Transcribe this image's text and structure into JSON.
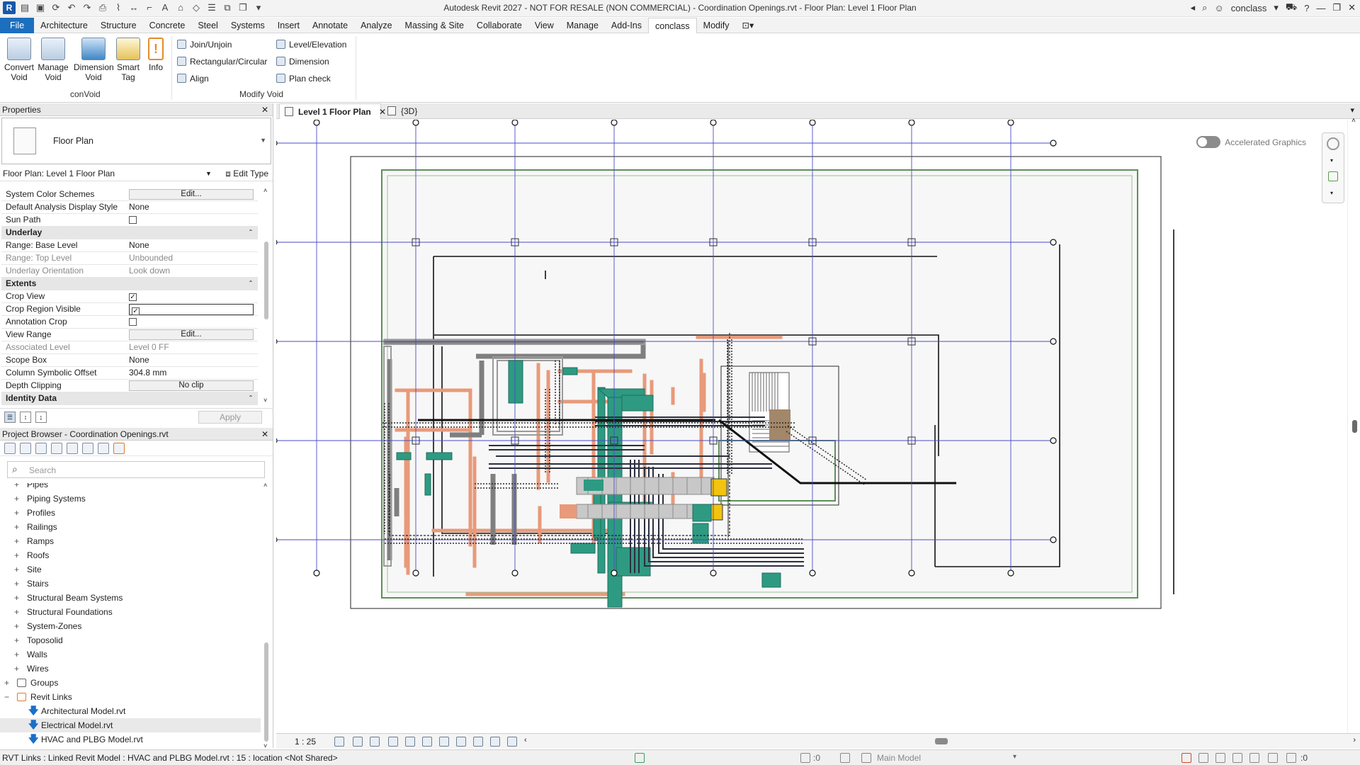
{
  "titlebar": {
    "title": "Autodesk Revit 2027 - NOT FOR RESALE (NON COMMERCIAL) - Coordination Openings.rvt - Floor Plan: Level 1 Floor Plan",
    "app_letter": "R",
    "user": "conclass"
  },
  "menu": {
    "file": "File",
    "tabs": [
      "Architecture",
      "Structure",
      "Concrete",
      "Steel",
      "Systems",
      "Insert",
      "Annotate",
      "Analyze",
      "Massing & Site",
      "Collaborate",
      "View",
      "Manage",
      "Add-Ins",
      "conclass",
      "Modify"
    ],
    "active_tab": "conclass"
  },
  "ribbon": {
    "big_buttons": [
      {
        "line1": "Convert",
        "line2": "Void"
      },
      {
        "line1": "Manage",
        "line2": "Void"
      },
      {
        "line1": "Dimension",
        "line2": "Void"
      },
      {
        "line1": "Smart",
        "line2": "Tag"
      },
      {
        "line1": "Info",
        "line2": ""
      }
    ],
    "panel1_label": "conVoid",
    "small_col1": [
      "Join/Unjoin",
      "Rectangular/Circular",
      "Align"
    ],
    "small_col2": [
      "Level/Elevation",
      "Dimension",
      "Plan check"
    ],
    "panel2_label": "Modify Void"
  },
  "properties": {
    "header": "Properties",
    "type_name": "Floor Plan",
    "instance_selector": "Floor Plan: Level 1 Floor Plan",
    "edit_type": "Edit Type",
    "rows": [
      {
        "k": "System Color Schemes",
        "v": "Edit...",
        "kind": "button"
      },
      {
        "k": "Default Analysis Display Style",
        "v": "None"
      },
      {
        "k": "Sun Path",
        "v": "",
        "kind": "check",
        "checked": false
      },
      {
        "k": "Underlay",
        "kind": "section"
      },
      {
        "k": "Range: Base Level",
        "v": "None"
      },
      {
        "k": "Range: Top Level",
        "v": "Unbounded",
        "ro": true
      },
      {
        "k": "Underlay Orientation",
        "v": "Look down",
        "ro": true
      },
      {
        "k": "Extents",
        "kind": "section"
      },
      {
        "k": "Crop View",
        "v": "",
        "kind": "check",
        "checked": true
      },
      {
        "k": "Crop Region Visible",
        "v": "",
        "kind": "checkbox-input",
        "checked": true
      },
      {
        "k": "Annotation Crop",
        "v": "",
        "kind": "check",
        "checked": false
      },
      {
        "k": "View Range",
        "v": "Edit...",
        "kind": "button"
      },
      {
        "k": "Associated Level",
        "v": "Level 0 FF",
        "ro": true
      },
      {
        "k": "Scope Box",
        "v": "None"
      },
      {
        "k": "Column Symbolic Offset",
        "v": "304.8 mm"
      },
      {
        "k": "Depth Clipping",
        "v": "No clip",
        "kind": "button"
      },
      {
        "k": "Identity Data",
        "kind": "section"
      }
    ],
    "apply": "Apply"
  },
  "browser": {
    "header": "Project Browser - Coordination Openings.rvt",
    "search_placeholder": "Search",
    "items": [
      {
        "label": "Pipes",
        "level": 1
      },
      {
        "label": "Piping Systems",
        "level": 1
      },
      {
        "label": "Profiles",
        "level": 1
      },
      {
        "label": "Railings",
        "level": 1
      },
      {
        "label": "Ramps",
        "level": 1
      },
      {
        "label": "Roofs",
        "level": 1
      },
      {
        "label": "Site",
        "level": 1
      },
      {
        "label": "Stairs",
        "level": 1
      },
      {
        "label": "Structural Beam Systems",
        "level": 1
      },
      {
        "label": "Structural Foundations",
        "level": 1
      },
      {
        "label": "System-Zones",
        "level": 1
      },
      {
        "label": "Toposolid",
        "level": 1
      },
      {
        "label": "Walls",
        "level": 1
      },
      {
        "label": "Wires",
        "level": 1
      },
      {
        "label": "Groups",
        "level": 0,
        "sign": "+"
      },
      {
        "label": "Revit Links",
        "level": 0,
        "sign": "−"
      }
    ],
    "links": [
      "Architectural Model.rvt",
      "Electrical Model.rvt",
      "HVAC and PLBG Model.rvt"
    ],
    "selected_link": "Electrical Model.rvt"
  },
  "view_tabs": [
    {
      "label": "Level 1 Floor Plan",
      "active": true
    },
    {
      "label": "{3D}",
      "active": false
    }
  ],
  "canvas": {
    "accelerated_graphics": "Accelerated Graphics"
  },
  "view_control": {
    "scale": "1 : 25"
  },
  "status": {
    "message": "RVT Links : Linked Revit Model : HVAC and PLBG Model.rvt : 15 : location <Not Shared>",
    "workset_count": ":0",
    "model": "Main Model",
    "filter_count": ":0"
  },
  "colors": {
    "grid": "#4b4bc8",
    "duct_green": "#2e9a82",
    "pipe_orange": "#e89a7a",
    "pipe_gray": "#8a8a8a",
    "equipment_yellow": "#f2c40f",
    "file_tab": "#1c6fbf"
  }
}
